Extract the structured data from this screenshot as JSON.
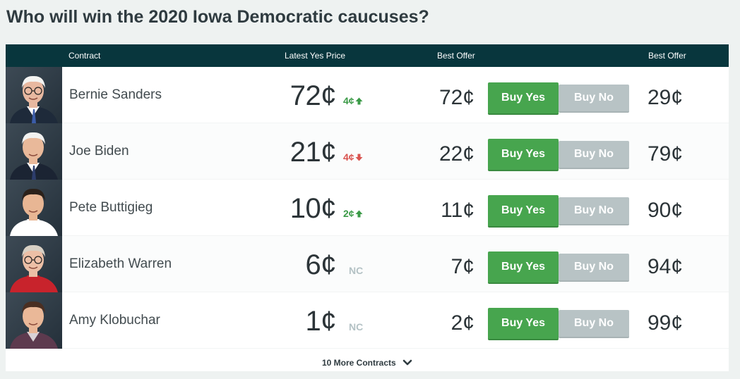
{
  "page": {
    "title": "Who will win the 2020 Iowa Democratic caucuses?"
  },
  "table": {
    "headers": {
      "contract": "Contract",
      "latest_yes_price": "Latest Yes Price",
      "best_offer_yes": "Best Offer",
      "best_offer_no": "Best Offer"
    },
    "rows": [
      {
        "name": "Bernie Sanders",
        "price": "72¢",
        "change": "4¢",
        "direction": "up",
        "best_offer_yes": "72¢",
        "buy_yes": "Buy Yes",
        "buy_no": "Buy No",
        "best_offer_no": "29¢",
        "avatar_icon": "person-photo-icon"
      },
      {
        "name": "Joe Biden",
        "price": "21¢",
        "change": "4¢",
        "direction": "down",
        "best_offer_yes": "22¢",
        "buy_yes": "Buy Yes",
        "buy_no": "Buy No",
        "best_offer_no": "79¢",
        "avatar_icon": "person-photo-icon"
      },
      {
        "name": "Pete Buttigieg",
        "price": "10¢",
        "change": "2¢",
        "direction": "up",
        "best_offer_yes": "11¢",
        "buy_yes": "Buy Yes",
        "buy_no": "Buy No",
        "best_offer_no": "90¢",
        "avatar_icon": "person-photo-icon"
      },
      {
        "name": "Elizabeth Warren",
        "price": "6¢",
        "change": "NC",
        "direction": "none",
        "best_offer_yes": "7¢",
        "buy_yes": "Buy Yes",
        "buy_no": "Buy No",
        "best_offer_no": "94¢",
        "avatar_icon": "person-photo-icon"
      },
      {
        "name": "Amy Klobuchar",
        "price": "1¢",
        "change": "NC",
        "direction": "none",
        "best_offer_yes": "2¢",
        "buy_yes": "Buy Yes",
        "buy_no": "Buy No",
        "best_offer_no": "99¢",
        "avatar_icon": "person-photo-icon"
      }
    ],
    "more_contracts": "10 More Contracts"
  },
  "colors": {
    "header_bg": "#08363d",
    "buy_yes": "#47a54e",
    "buy_no": "#b8c3c5",
    "change_up": "#3b9a47",
    "change_down": "#d9534f",
    "change_nc": "#b4c2c5"
  },
  "icons": {
    "up": "arrow-up-icon",
    "down": "arrow-down-icon",
    "more": "chevron-down-icon"
  }
}
